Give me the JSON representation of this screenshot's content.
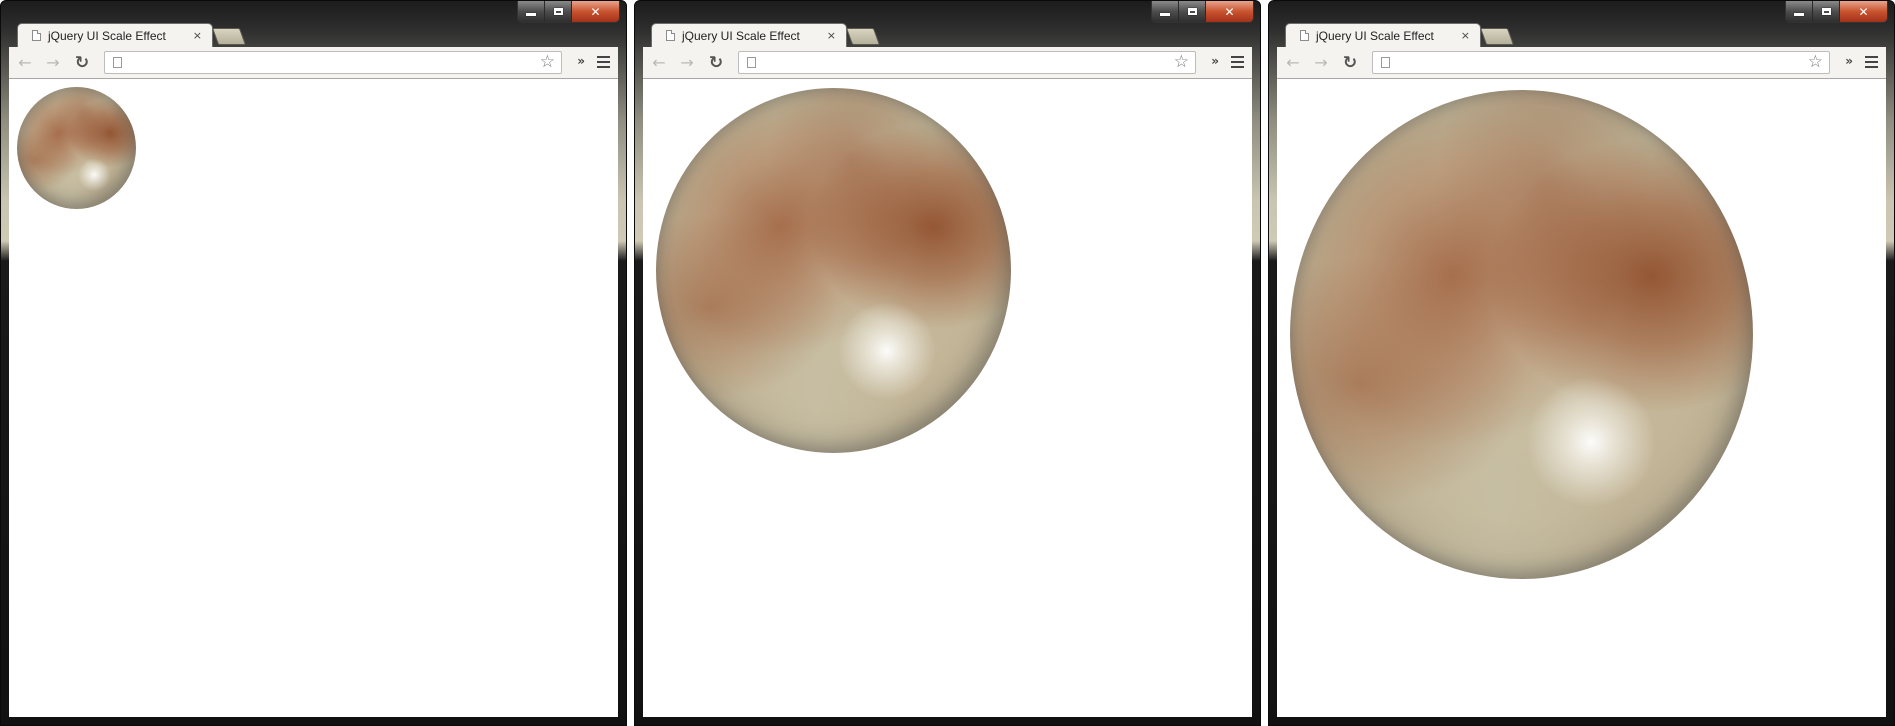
{
  "windows": [
    {
      "tab_title": "jQuery UI Scale Effect",
      "tab_close": "×",
      "address": ""
    },
    {
      "tab_title": "jQuery UI Scale Effect",
      "tab_close": "×",
      "address": ""
    },
    {
      "tab_title": "jQuery UI Scale Effect",
      "tab_close": "×",
      "address": ""
    }
  ],
  "icons": {
    "back": "back-arrow-icon",
    "forward": "forward-arrow-icon",
    "reload": "reload-icon",
    "star": "bookmark-star-icon",
    "chevrons": "extensions-chevron-icon",
    "menu": "hamburger-menu-icon",
    "page": "page-icon",
    "minimize": "minimize-icon",
    "maximize": "maximize-icon",
    "close": "close-icon"
  },
  "glyphs": {
    "back": "←",
    "forward": "→",
    "reload": "↻",
    "star": "☆",
    "chevrons": "»",
    "close": "✕"
  },
  "colors": {
    "window_frame": "#1c1c1c",
    "toolbar": "#f4f3ef",
    "close_button": "#c9532f",
    "viewport": "#ffffff"
  }
}
